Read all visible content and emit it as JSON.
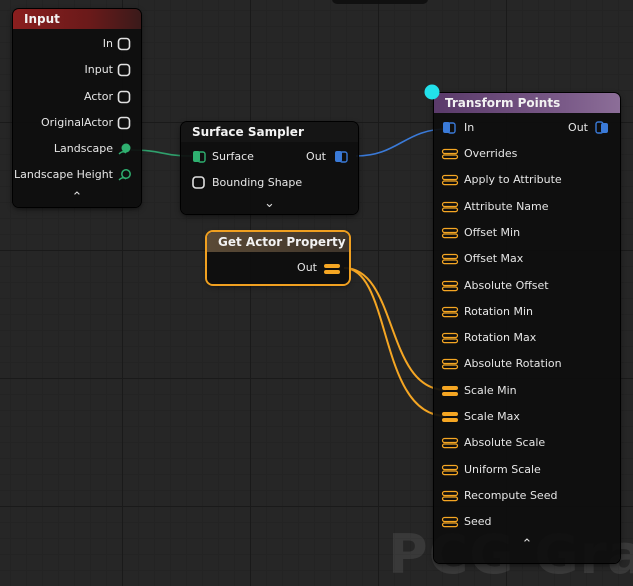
{
  "watermark": "PCG Graph",
  "nodes": {
    "input": {
      "title": "Input",
      "header_color": "#6e1a1a",
      "pins": [
        "In",
        "Input",
        "Actor",
        "OriginalActor",
        "Landscape",
        "Landscape Height"
      ],
      "collapse_glyph": "⌃"
    },
    "surface_sampler": {
      "title": "Surface Sampler",
      "inputs": [
        "Surface",
        "Bounding Shape"
      ],
      "output": "Out",
      "expand_glyph": "⌄"
    },
    "get_actor_property": {
      "title": "Get Actor Property",
      "output": "Out",
      "border_color": "#f0a020"
    },
    "transform_points": {
      "title": "Transform Points",
      "header_color": "#6a4a78",
      "in_label": "In",
      "out_label": "Out",
      "pins": [
        "Overrides",
        "Apply to Attribute",
        "Attribute Name",
        "Offset Min",
        "Offset Max",
        "Absolute Offset",
        "Rotation Min",
        "Rotation Max",
        "Absolute Rotation",
        "Scale Min",
        "Scale Max",
        "Absolute Scale",
        "Uniform Scale",
        "Recompute Seed",
        "Seed"
      ],
      "connected_pins": [
        "Scale Min",
        "Scale Max"
      ],
      "collapse_glyph": "⌃"
    }
  },
  "colors": {
    "landscape_wire": "#2fa06c",
    "point_wire": "#3a7ad8",
    "property_wire": "#f5a623",
    "selection_dot": "#22e0ea"
  }
}
